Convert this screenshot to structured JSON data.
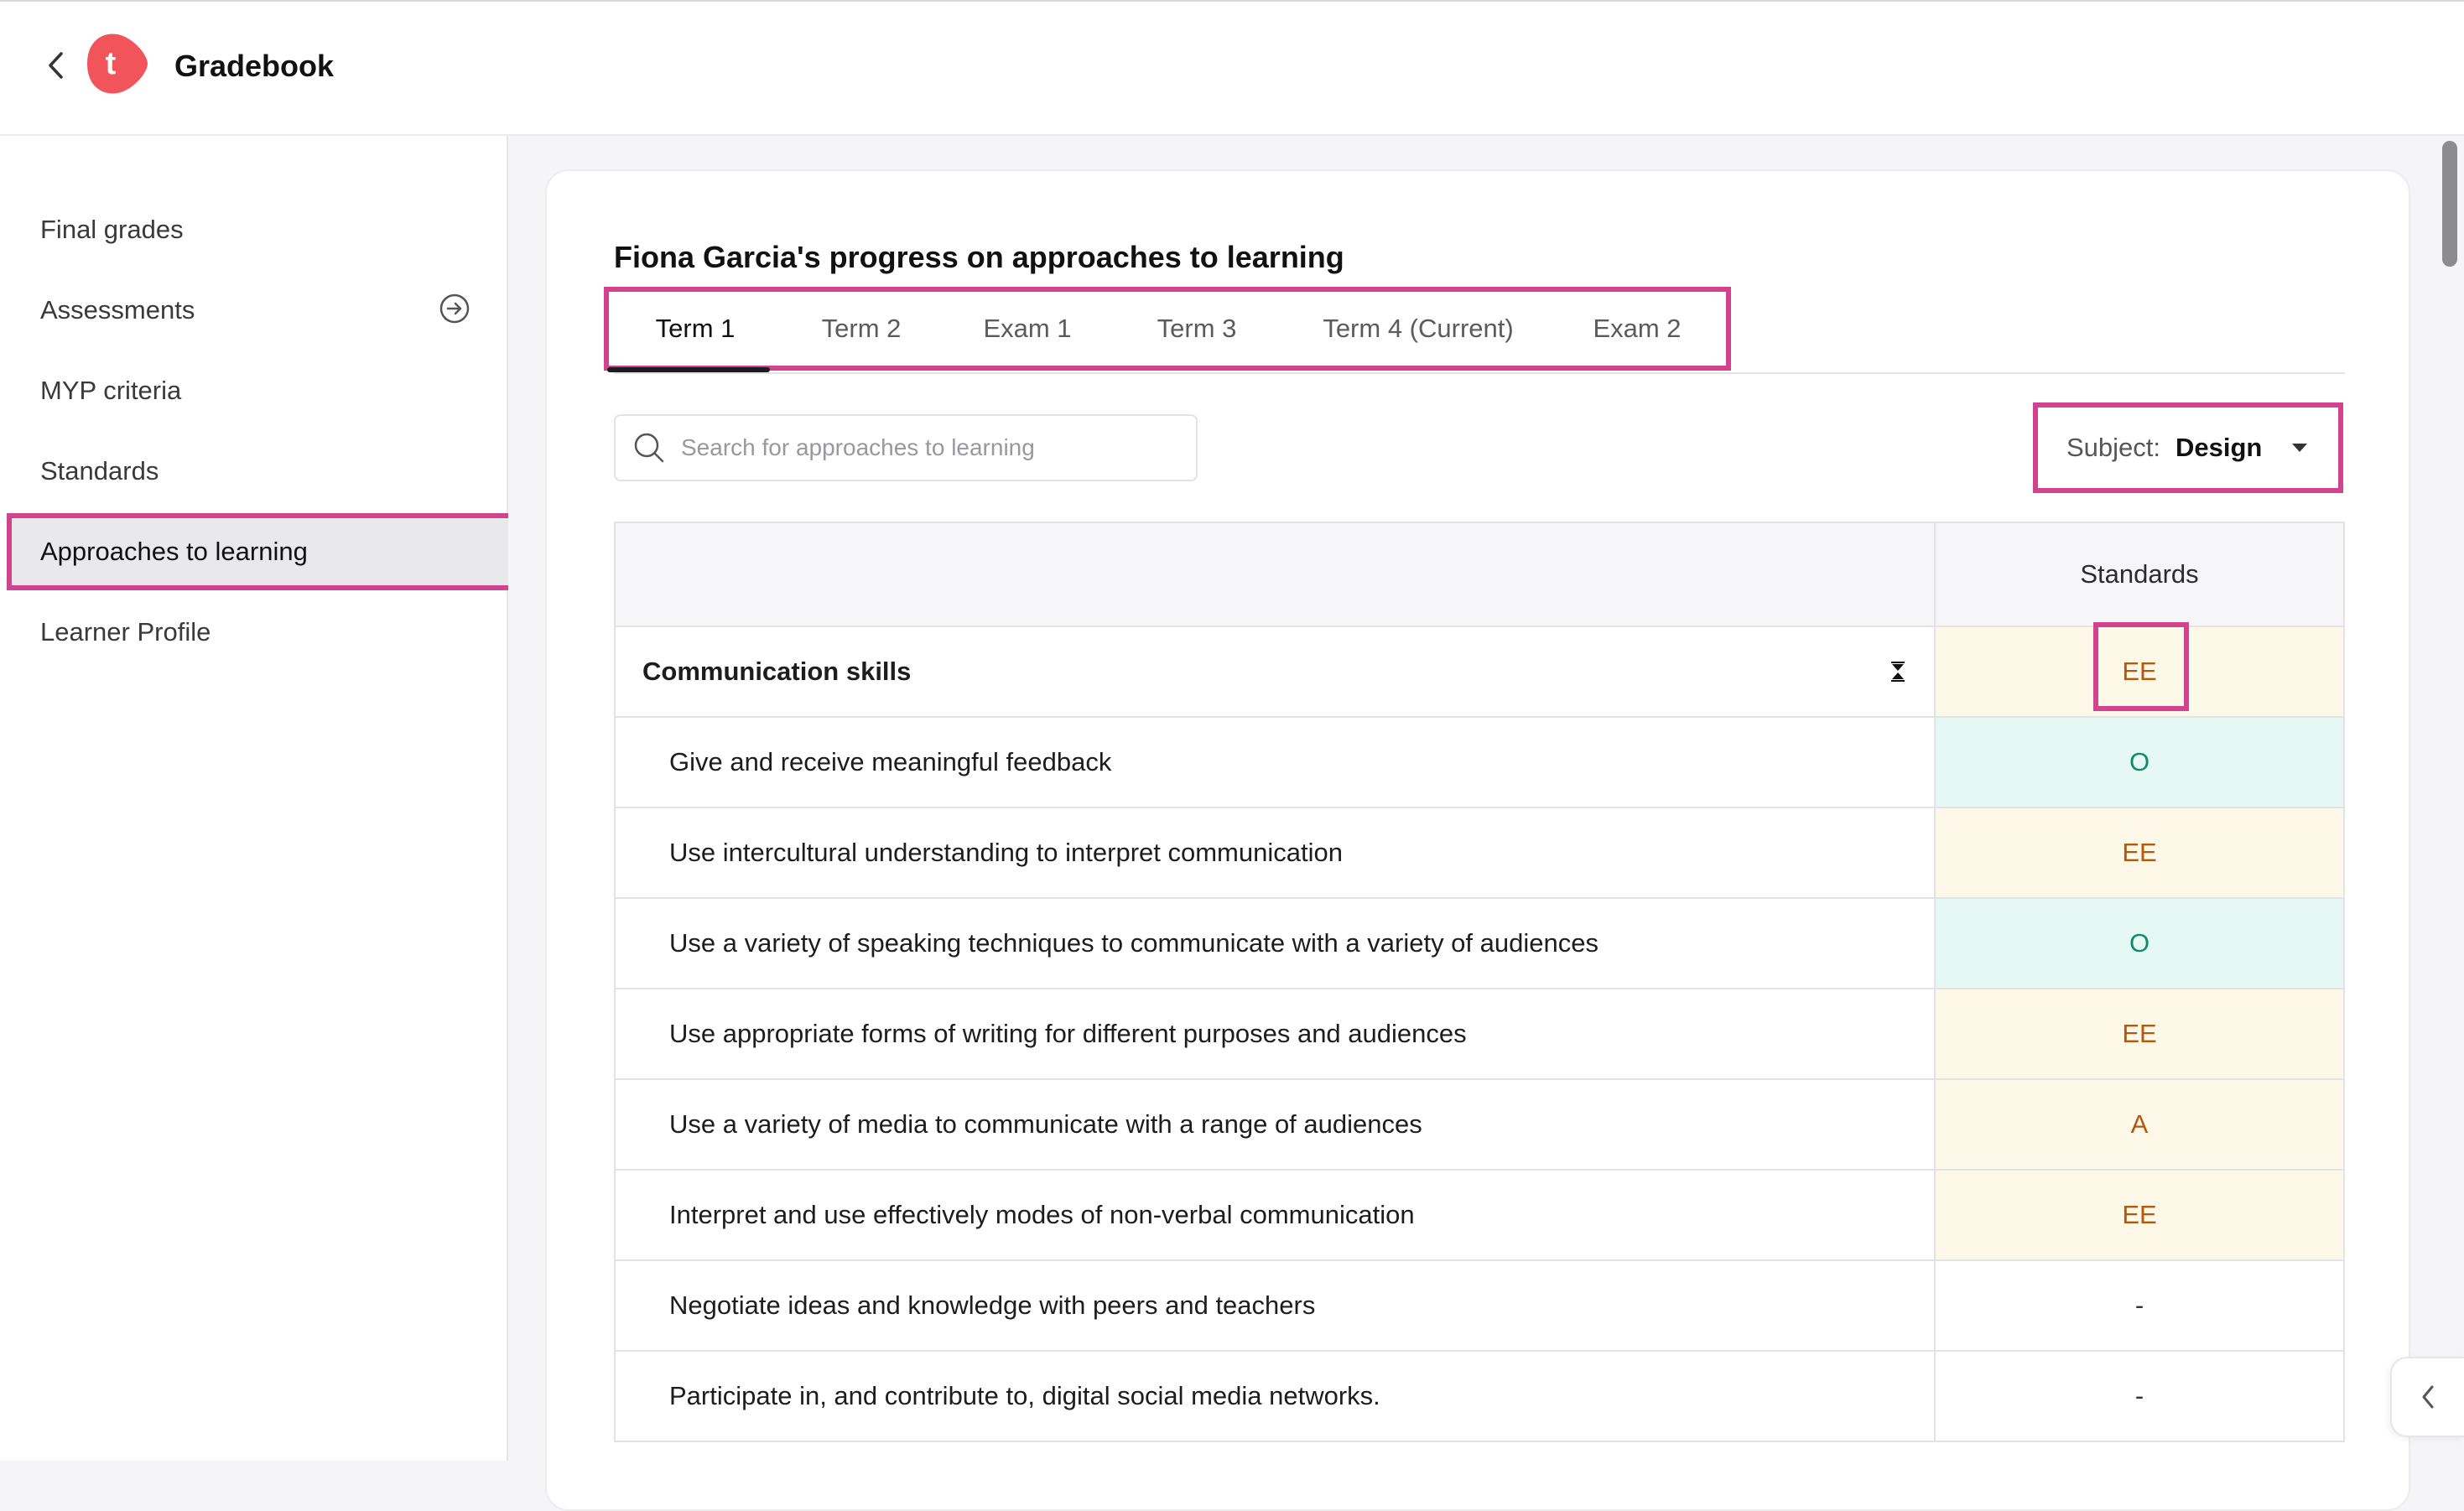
{
  "header": {
    "title": "Gradebook",
    "logo_letter": "t",
    "brand_color": "#f2545b"
  },
  "sidebar": {
    "items": [
      {
        "label": "Final grades"
      },
      {
        "label": "Assessments",
        "icon": "arrow-right-circle-icon"
      },
      {
        "label": "MYP criteria"
      },
      {
        "label": "Standards"
      },
      {
        "label": "Approaches to learning",
        "active": true
      },
      {
        "label": "Learner Profile"
      }
    ]
  },
  "main": {
    "title": "Fiona Garcia's progress on approaches to learning",
    "tabs": [
      {
        "label": "Term 1",
        "active": true
      },
      {
        "label": "Term 2"
      },
      {
        "label": "Exam 1"
      },
      {
        "label": "Term 3"
      },
      {
        "label": "Term 4 (Current)"
      },
      {
        "label": "Exam 2"
      }
    ],
    "search": {
      "placeholder": "Search for approaches to learning",
      "value": ""
    },
    "subject": {
      "label": "Subject:",
      "value": "Design"
    },
    "table": {
      "column_header": "Standards",
      "group": {
        "label": "Communication skills",
        "grade": "EE"
      },
      "rows": [
        {
          "label": "Give and receive meaningful feedback",
          "grade": "O"
        },
        {
          "label": "Use intercultural understanding to interpret communication",
          "grade": "EE"
        },
        {
          "label": "Use a variety of speaking techniques to communicate with a variety of audiences",
          "grade": "O"
        },
        {
          "label": "Use appropriate forms of writing for different purposes and audiences",
          "grade": "EE"
        },
        {
          "label": "Use a variety of media to communicate with a range of audiences",
          "grade": "A"
        },
        {
          "label": "Interpret and use effectively modes of non-verbal communication",
          "grade": "EE"
        },
        {
          "label": "Negotiate ideas and knowledge with peers and teachers",
          "grade": "-"
        },
        {
          "label": "Participate in, and contribute to, digital social media networks.",
          "grade": "-"
        }
      ]
    }
  },
  "colors": {
    "highlight": "#d1438f",
    "grade_ee_bg": "#fef8e8",
    "grade_o_bg": "#e6f8f3"
  }
}
